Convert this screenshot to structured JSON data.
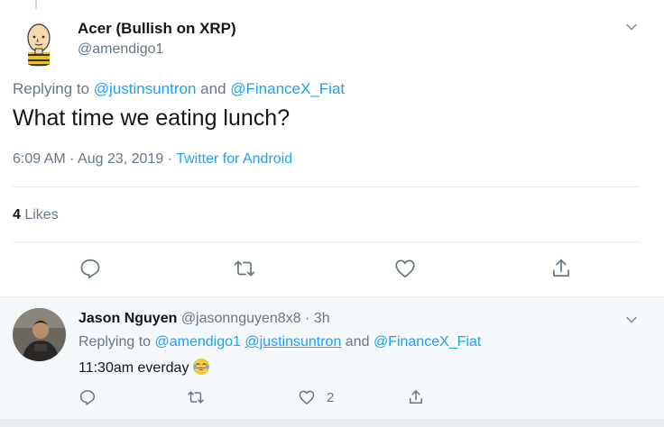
{
  "tweet": {
    "author_name": "Acer (Bullish on XRP)",
    "author_handle": "@amendigo1",
    "replying_prefix": "Replying to ",
    "replying_user1": "@justinsuntron",
    "replying_and": " and ",
    "replying_user2": "@FinanceX_Fiat",
    "text": "What time we eating lunch?",
    "time": "6:09 AM",
    "separator": " · ",
    "date": "Aug 23, 2019",
    "source": "Twitter for Android",
    "likes_count": "4",
    "likes_label": " Likes",
    "icons": {
      "menu": "chevron-down-icon",
      "reply": "reply-icon",
      "retweet": "retweet-icon",
      "like": "heart-icon",
      "share": "share-icon"
    }
  },
  "reply": {
    "author_name": "Jason Nguyen",
    "author_handle": "@jasonnguyen8x8",
    "time_sep": " · ",
    "time": "3h",
    "replying_prefix": "Replying to ",
    "replying_user1": "@amendigo1",
    "replying_user2": "@justinsuntron",
    "replying_and": " and ",
    "replying_user3": "@FinanceX_Fiat",
    "text": "11:30am everday",
    "emoji": "tears-of-joy-emoji",
    "likes_count": "2"
  },
  "colors": {
    "link": "#1da1f2",
    "secondary_text": "#657786",
    "primary_text": "#14171a",
    "reply_background": "#f5f8fa",
    "divider": "#e6ecf0"
  }
}
